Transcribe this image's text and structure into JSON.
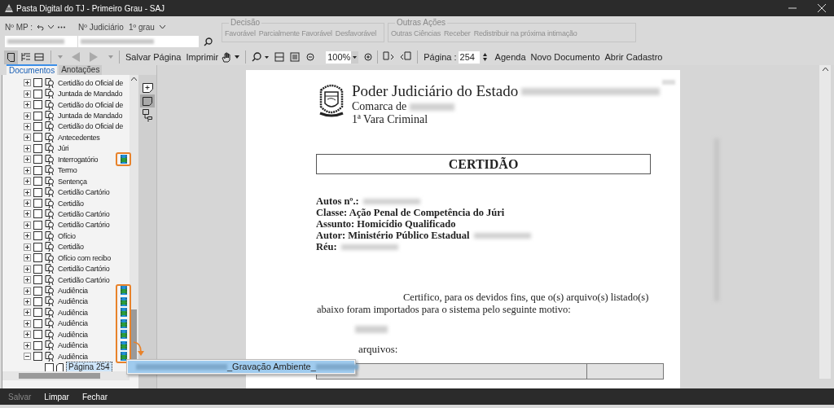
{
  "window": {
    "title": "Pasta Digital do TJ - Primeiro Grau - SAJ"
  },
  "header": {
    "mp_label": "Nº MP :",
    "judicial_label": "Nº Judiciário",
    "degree": "1º grau"
  },
  "groups": [
    {
      "title": "Decisão",
      "buttons": [
        {
          "label": "Favorável",
          "disabled": true
        },
        {
          "label": "Parcialmente Favorável",
          "disabled": true
        },
        {
          "label": "Desfavorável",
          "disabled": true
        }
      ]
    },
    {
      "title": "Outras Ações",
      "buttons": [
        {
          "label": "Outras Ciências",
          "disabled": true
        },
        {
          "label": "Receber",
          "disabled": true
        },
        {
          "label": "Redistribuir na próxima intimação",
          "disabled": true
        }
      ]
    }
  ],
  "toolbar": {
    "save_page": {
      "label": "Salvar Página"
    },
    "print": {
      "label": "Imprimir"
    },
    "zoom": "100%",
    "page_label": "Página :",
    "page_value": "254",
    "links": [
      {
        "label": "Agenda"
      },
      {
        "label": "Novo Documento"
      },
      {
        "label": "Abrir Cadastro"
      }
    ]
  },
  "tabs": [
    {
      "label": "Documentos",
      "selected": true
    },
    {
      "label": "Anotações",
      "selected": false
    }
  ],
  "tree": [
    {
      "label": "Certidão do Oficial de",
      "checked": false,
      "media": false,
      "expanded": false
    },
    {
      "label": "Juntada de Mandado",
      "checked": false,
      "media": false,
      "expanded": false
    },
    {
      "label": "Certidão do Oficial de",
      "checked": false,
      "media": false,
      "expanded": false
    },
    {
      "label": "Juntada de Mandado",
      "checked": false,
      "media": false,
      "expanded": false
    },
    {
      "label": "Certidão do Oficial de",
      "checked": false,
      "media": false,
      "expanded": false
    },
    {
      "label": "Antecedentes",
      "checked": false,
      "media": false,
      "expanded": false
    },
    {
      "label": "Júri",
      "checked": false,
      "media": false,
      "expanded": false
    },
    {
      "label": "Interrogatório",
      "checked": false,
      "media": true,
      "expanded": false
    },
    {
      "label": "Termo",
      "checked": false,
      "media": false,
      "expanded": false
    },
    {
      "label": "Sentença",
      "checked": false,
      "media": false,
      "expanded": false
    },
    {
      "label": "Certidão Cartório",
      "checked": false,
      "media": false,
      "expanded": false
    },
    {
      "label": "Certidão",
      "checked": false,
      "media": false,
      "expanded": false
    },
    {
      "label": "Certidão Cartório",
      "checked": false,
      "media": false,
      "expanded": false
    },
    {
      "label": "Certidão Cartório",
      "checked": false,
      "media": false,
      "expanded": false
    },
    {
      "label": "Ofício",
      "checked": false,
      "media": false,
      "expanded": false
    },
    {
      "label": "Certidão",
      "checked": false,
      "media": false,
      "expanded": false
    },
    {
      "label": "Ofício com recibo",
      "checked": false,
      "media": false,
      "expanded": false
    },
    {
      "label": "Certidão Cartório",
      "checked": false,
      "media": false,
      "expanded": false
    },
    {
      "label": "Certidão Cartório",
      "checked": false,
      "media": false,
      "expanded": false
    },
    {
      "label": "Audiência",
      "checked": false,
      "media": true,
      "expanded": false
    },
    {
      "label": "Audiência",
      "checked": false,
      "media": true,
      "expanded": false
    },
    {
      "label": "Audiência",
      "checked": false,
      "media": true,
      "expanded": false
    },
    {
      "label": "Audiência",
      "checked": false,
      "media": true,
      "expanded": false
    },
    {
      "label": "Audiência",
      "checked": false,
      "media": true,
      "expanded": false
    },
    {
      "label": "Audiência",
      "checked": false,
      "media": true,
      "expanded": false
    },
    {
      "label": "Audiência",
      "checked": false,
      "media": true,
      "expanded": true,
      "children": [
        {
          "label": "Página 254",
          "checked": false,
          "selected": true
        }
      ]
    }
  ],
  "media_popup": {
    "label": "_Gravação Ambiente_"
  },
  "document": {
    "heading": [
      {
        "text": "Poder Judiciário do Estado",
        "redacted": true
      },
      {
        "text": "Comarca de",
        "redacted": true
      },
      {
        "text": "1ª Vara Criminal",
        "redacted": false
      }
    ],
    "title": "CERTIDÃO",
    "fields": [
      {
        "text": "Autos nº.:",
        "redacted": true
      },
      {
        "text": "Classe: Ação Penal de Competência do Júri",
        "redacted": false
      },
      {
        "text": "Assunto: Homicídio Qualificado",
        "redacted": false
      },
      {
        "text": "Autor: Ministério Público Estadual",
        "redacted": true
      },
      {
        "text": "Réu:",
        "redacted": true
      }
    ],
    "paragraph": "Certifico, para os devidos fins, que o(s) arquivo(s) listado(s) abaixo foram importados para o sistema pelo seguinte motivo:",
    "list_intro": "arquivos:"
  },
  "footer": [
    {
      "label": "Salvar",
      "disabled": true
    },
    {
      "label": "Limpar",
      "disabled": false
    },
    {
      "label": "Fechar",
      "disabled": false
    }
  ]
}
